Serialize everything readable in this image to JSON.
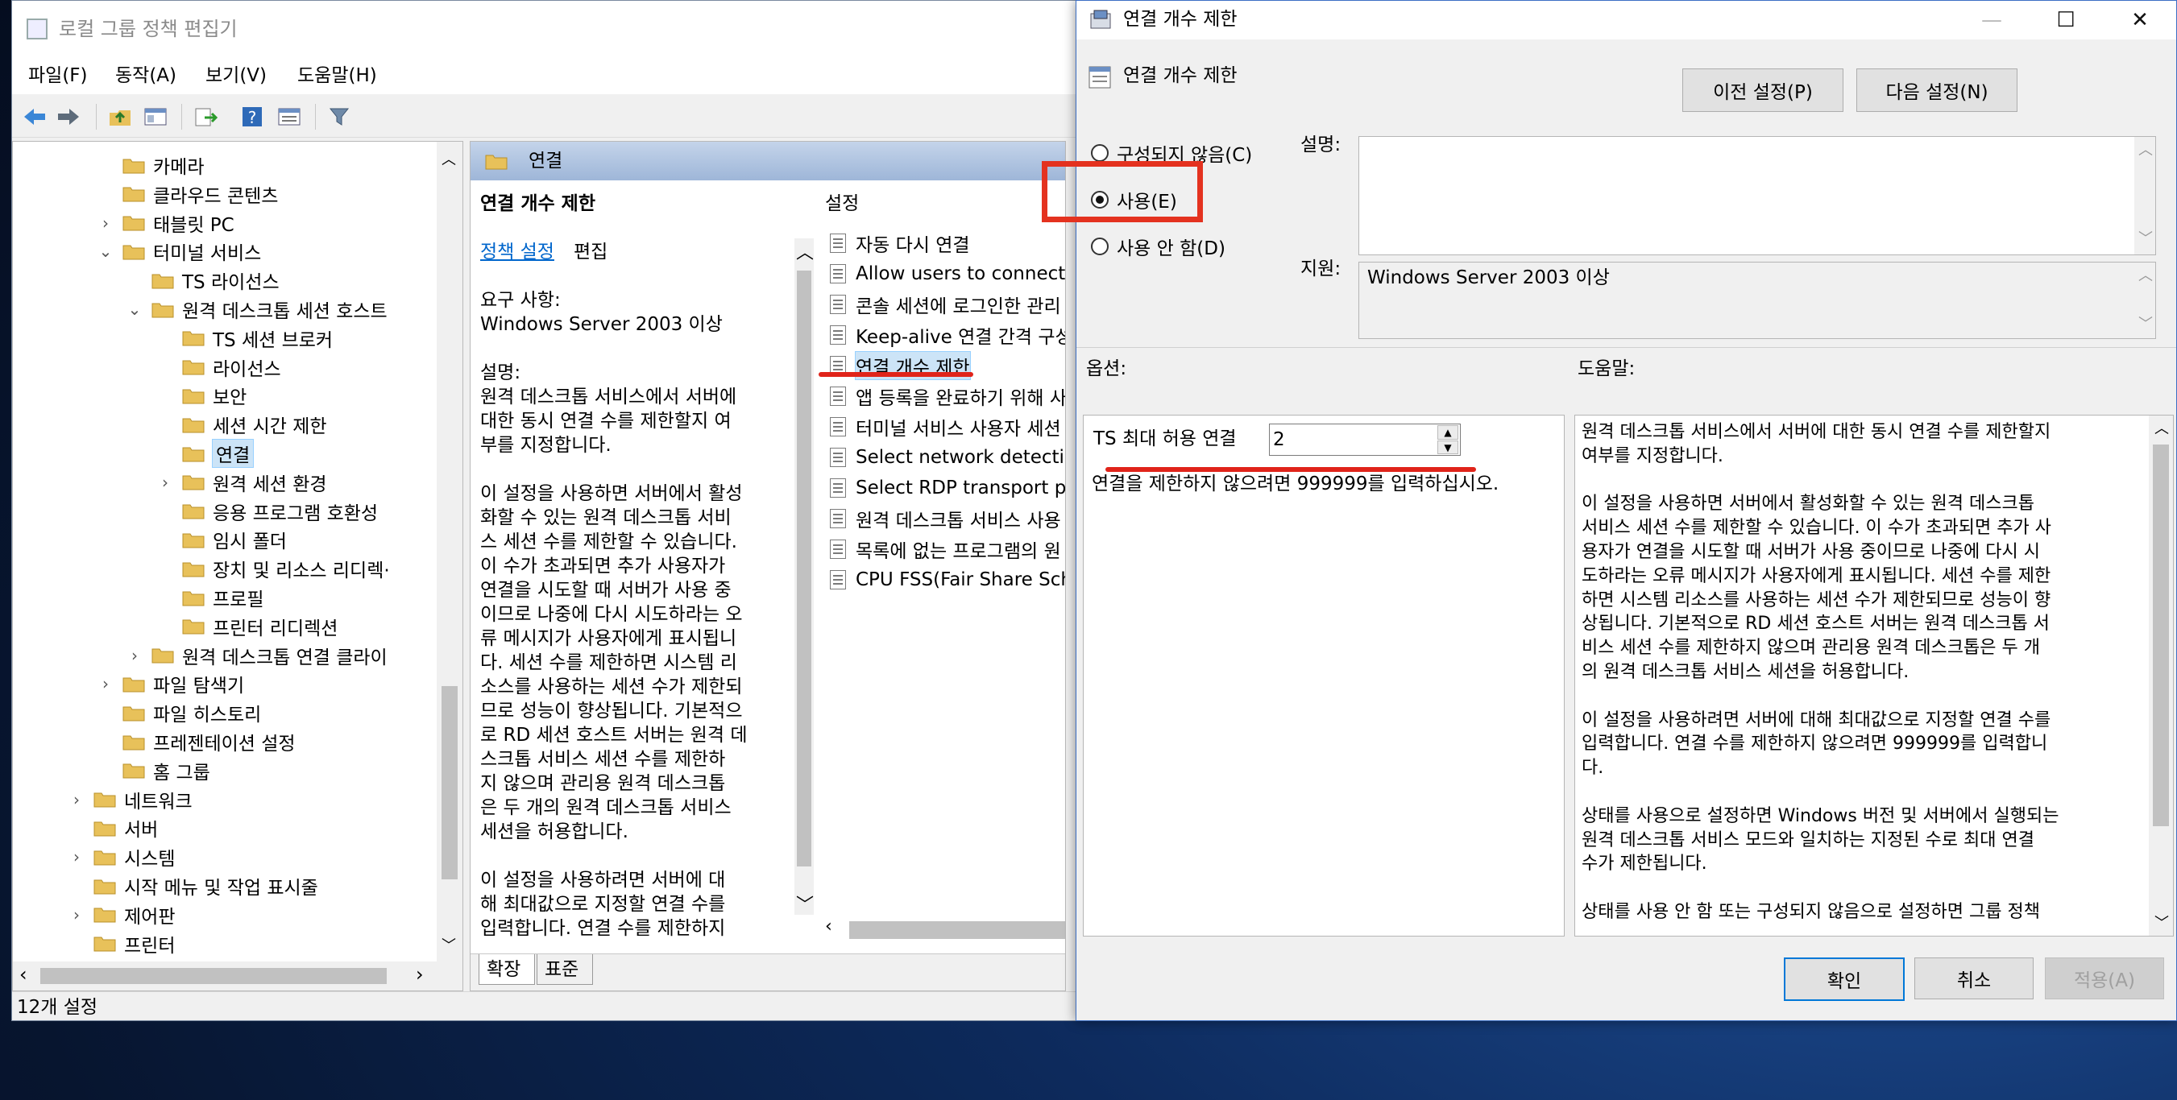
{
  "gpedit": {
    "title": "로컬 그룹 정책 편집기",
    "menu": [
      "파일(F)",
      "동작(A)",
      "보기(V)",
      "도움말(H)"
    ],
    "toolbar_icons": [
      "back-arrow-icon",
      "forward-arrow-icon",
      "up-folder-icon",
      "show-hide-tree-icon",
      "export-list-icon",
      "help-icon",
      "properties-icon",
      "filter-icon"
    ],
    "tree": [
      {
        "label": "카메라",
        "expander": ""
      },
      {
        "label": "클라우드 콘텐츠",
        "expander": ""
      },
      {
        "label": "태블릿 PC",
        "expander": "›"
      },
      {
        "label": "터미널 서비스",
        "expander": "⌄"
      },
      {
        "label": "TS 라이선스",
        "expander": ""
      },
      {
        "label": "원격 데스크톱 세션 호스트",
        "expander": "⌄"
      },
      {
        "label": "TS 세션 브로커",
        "expander": ""
      },
      {
        "label": "라이선스",
        "expander": ""
      },
      {
        "label": "보안",
        "expander": ""
      },
      {
        "label": "세션 시간 제한",
        "expander": ""
      },
      {
        "label": "연결",
        "expander": ""
      },
      {
        "label": "원격 세션 환경",
        "expander": "›"
      },
      {
        "label": "응용 프로그램 호환성",
        "expander": ""
      },
      {
        "label": "임시 폴더",
        "expander": ""
      },
      {
        "label": "장치 및 리소스 리디렉·",
        "expander": ""
      },
      {
        "label": "프로필",
        "expander": ""
      },
      {
        "label": "프린터 리디렉션",
        "expander": ""
      },
      {
        "label": "원격 데스크톱 연결 클라이",
        "expander": "›"
      },
      {
        "label": "파일 탐색기",
        "expander": "›"
      },
      {
        "label": "파일 히스토리",
        "expander": ""
      },
      {
        "label": "프레젠테이션 설정",
        "expander": ""
      },
      {
        "label": "홈 그룹",
        "expander": ""
      },
      {
        "label": "네트워크",
        "expander": "›"
      },
      {
        "label": "서버",
        "expander": ""
      },
      {
        "label": "시스템",
        "expander": "›"
      },
      {
        "label": "시작 메뉴 및 작업 표시줄",
        "expander": ""
      },
      {
        "label": "제어판",
        "expander": "›"
      },
      {
        "label": "프린터",
        "expander": ""
      }
    ],
    "folder_header": "연결",
    "desc_panel": {
      "title": "연결 개수 제한",
      "edit_link": "정책 설정",
      "edit_suffix": "편집",
      "lines": [
        "요구 사항:",
        "Windows Server 2003 이상",
        "",
        "설명:",
        "원격 데스크톱 서비스에서 서버에",
        "대한 동시 연결 수를 제한할지 여",
        "부를 지정합니다.",
        "",
        "이 설정을 사용하면 서버에서 활성",
        "화할 수 있는 원격 데스크톱 서비",
        "스 세션 수를 제한할 수 있습니다.",
        "이 수가 초과되면 추가 사용자가",
        "연결을 시도할 때 서버가 사용 중",
        "이므로 나중에 다시 시도하라는 오",
        "류 메시지가 사용자에게 표시됩니",
        "다. 세션 수를 제한하면 시스템 리",
        "소스를 사용하는 세션 수가 제한되",
        "므로 성능이 향상됩니다. 기본적으",
        "로 RD 세션 호스트 서버는 원격 데",
        "스크톱 서비스 세션 수를 제한하",
        "지 않으며 관리용 원격 데스크톱",
        "은 두 개의 원격 데스크톱 서비스",
        "세션을 허용합니다.",
        "",
        "이 설정을 사용하려면 서버에 대",
        "해 최대값으로 지정할 연결 수를",
        "입력합니다. 연결 수를 제한하지"
      ]
    },
    "settings_header": "설정",
    "policies": [
      "자동 다시 연결",
      "Allow users to connect rer",
      "콘솔 세션에 로그인한 관리",
      "Keep-alive 연결 간격 구성",
      "연결 개수 제한",
      "앱 등록을 완료하기 위해 사",
      "터미널 서비스 사용자 세션",
      "Select network detection o",
      "Select RDP transport proto",
      "원격 데스크톱 서비스 사용",
      "목록에 없는 프로그램의 원",
      "CPU FSS(Fair Share Sched"
    ],
    "tabs": [
      "확장",
      "표준"
    ],
    "status": "12개 설정"
  },
  "dialog": {
    "title": "연결 개수 제한",
    "header_label": "연결 개수 제한",
    "prev_button": "이전 설정(P)",
    "next_button": "다음 설정(N)",
    "radio_not_configured": "구성되지 않음(C)",
    "radio_enabled": "사용(E)",
    "radio_disabled": "사용 안 함(D)",
    "selected_state": "사용(E)",
    "comment_label": "설명:",
    "supported_label": "지원:",
    "supported_value": "Windows Server 2003 이상",
    "options_label": "옵션:",
    "help_label": "도움말:",
    "option_field_label": "TS 최대 허용 연결",
    "option_field_value": "2",
    "option_hint": "연결을 제한하지 않으려면 999999를 입력하십시오.",
    "help_lines": [
      "원격 데스크톱 서비스에서 서버에 대한 동시 연결 수를 제한할지",
      "여부를 지정합니다.",
      "",
      "이 설정을 사용하면 서버에서 활성화할 수 있는 원격 데스크톱",
      "서비스 세션 수를 제한할 수 있습니다. 이 수가 초과되면 추가 사",
      "용자가 연결을 시도할 때 서버가 사용 중이므로 나중에 다시 시",
      "도하라는 오류 메시지가 사용자에게 표시됩니다. 세션 수를 제한",
      "하면 시스템 리소스를 사용하는 세션 수가 제한되므로 성능이 향",
      "상됩니다. 기본적으로 RD 세션 호스트 서버는 원격 데스크톱 서",
      "비스 세션 수를 제한하지 않으며 관리용 원격 데스크톱은 두 개",
      "의 원격 데스크톱 서비스 세션을 허용합니다.",
      "",
      "이 설정을 사용하려면 서버에 대해 최대값으로 지정할 연결 수를",
      "입력합니다. 연결 수를 제한하지 않으려면 999999를 입력합니",
      "다.",
      "",
      "상태를 사용으로 설정하면 Windows 버전 및 서버에서 실행되는",
      "원격 데스크톱 서비스 모드와 일치하는 지정된 수로 최대 연결",
      "수가 제한됩니다.",
      "",
      "상태를 사용 안 함 또는 구성되지 않음으로 설정하면 그룹 정책"
    ],
    "ok_button": "확인",
    "cancel_button": "취소",
    "apply_button": "적용(A)"
  },
  "colors": {
    "annotation_red": "#e4321f",
    "link_blue": "#0066cc",
    "selection": "#cce4f7",
    "folder_yellow": "#e8c15a"
  }
}
